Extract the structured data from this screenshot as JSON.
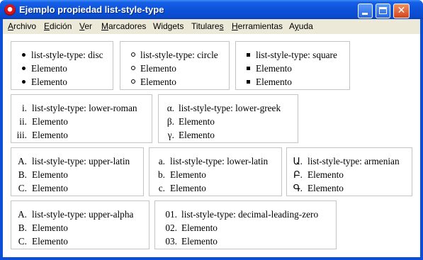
{
  "window": {
    "title": "Ejemplo propiedad list-style-type",
    "minimize_icon": "minimize-icon",
    "maximize_icon": "maximize-icon",
    "close_icon": "close-icon",
    "close_glyph": "✕"
  },
  "menu": [
    {
      "name": "menu-archivo",
      "pre": "",
      "u": "A",
      "post": "rchivo"
    },
    {
      "name": "menu-edicion",
      "pre": "",
      "u": "E",
      "post": "dición"
    },
    {
      "name": "menu-ver",
      "pre": "",
      "u": "V",
      "post": "er"
    },
    {
      "name": "menu-marcadores",
      "pre": "",
      "u": "M",
      "post": "arcadores"
    },
    {
      "name": "menu-widgets",
      "pre": "Widgets",
      "u": "",
      "post": ""
    },
    {
      "name": "menu-titulares",
      "pre": "Titulare",
      "u": "s",
      "post": ""
    },
    {
      "name": "menu-herramientas",
      "pre": "",
      "u": "H",
      "post": "erramientas"
    },
    {
      "name": "menu-ayuda",
      "pre": "A",
      "u": "y",
      "post": "uda"
    }
  ],
  "lists": [
    {
      "type": "disc",
      "markers": [
        "",
        "",
        ""
      ],
      "items": [
        "list-style-type: disc",
        "Elemento",
        "Elemento"
      ]
    },
    {
      "type": "circle",
      "markers": [
        "",
        "",
        ""
      ],
      "items": [
        "list-style-type: circle",
        "Elemento",
        "Elemento"
      ]
    },
    {
      "type": "square",
      "markers": [
        "",
        "",
        ""
      ],
      "items": [
        "list-style-type: square",
        "Elemento",
        "Elemento"
      ]
    },
    {
      "type": "lower-roman",
      "markers": [
        "i.",
        "ii.",
        "iii."
      ],
      "items": [
        "list-style-type: lower-roman",
        "Elemento",
        "Elemento"
      ]
    },
    {
      "type": "lower-greek",
      "markers": [
        "α.",
        "β.",
        "γ."
      ],
      "items": [
        "list-style-type: lower-greek",
        "Elemento",
        "Elemento"
      ]
    },
    {
      "type": "upper-latin",
      "markers": [
        "A.",
        "B.",
        "C."
      ],
      "items": [
        "list-style-type: upper-latin",
        "Elemento",
        "Elemento"
      ]
    },
    {
      "type": "lower-latin",
      "markers": [
        "a.",
        "b.",
        "c."
      ],
      "items": [
        "list-style-type: lower-latin",
        "Elemento",
        "Elemento"
      ]
    },
    {
      "type": "armenian",
      "markers": [
        "Ա.",
        "Բ.",
        "Գ."
      ],
      "items": [
        "list-style-type: armenian",
        "Elemento",
        "Elemento"
      ]
    },
    {
      "type": "upper-alpha",
      "markers": [
        "A.",
        "B.",
        "C."
      ],
      "items": [
        "list-style-type: upper-alpha",
        "Elemento",
        "Elemento"
      ]
    },
    {
      "type": "decimal-leading-zero",
      "markers": [
        "01.",
        "02.",
        "03."
      ],
      "items": [
        "list-style-type: decimal-leading-zero",
        "Elemento",
        "Elemento"
      ]
    }
  ]
}
